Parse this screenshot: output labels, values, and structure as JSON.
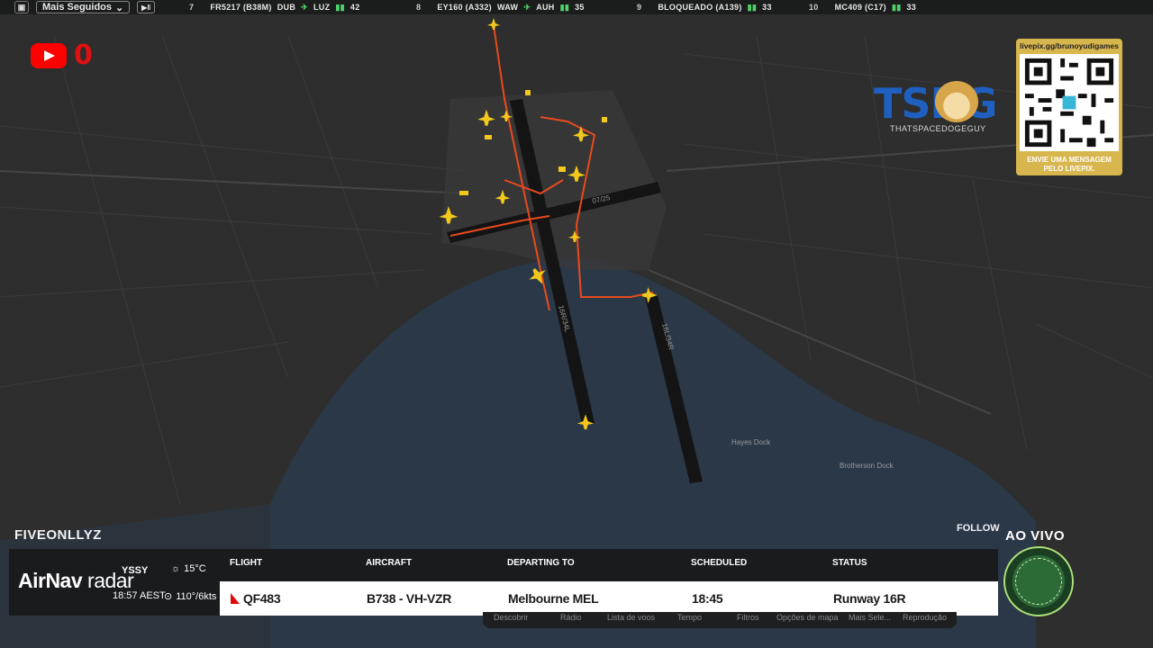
{
  "topbar": {
    "dropdown_label": "Mais Seguidos",
    "flights": [
      {
        "rank": "7",
        "callsign": "FR5217 (B38M)",
        "from": "DUB",
        "to": "LUZ",
        "count": "42"
      },
      {
        "rank": "8",
        "callsign": "EY160 (A332)",
        "from": "WAW",
        "to": "AUH",
        "count": "35"
      },
      {
        "rank": "9",
        "callsign": "BLOQUEADO (A139)",
        "from": "",
        "to": "",
        "count": "33"
      },
      {
        "rank": "10",
        "callsign": "MC409 (C17)",
        "from": "",
        "to": "",
        "count": "33"
      }
    ]
  },
  "overlay": {
    "youtube_count": "0",
    "tsdg_title": "TSDG",
    "tsdg_sub": "THATSPACEDOGEGUY",
    "livepix_url": "livepix.gg/brunoyudigames",
    "livepix_msg": "ENVIE UMA MENSAGEM PELO LIVEPIX."
  },
  "streamer": "FIVEONLLYZ",
  "follow_label": "FOLLOW",
  "live_label": "AO VIVO",
  "panel": {
    "brand_a": "AirNav",
    "brand_b": " radar",
    "airport": "YSSY",
    "local_time": "18:57 AEST",
    "temperature": "15°C",
    "wind": "110°/6kts",
    "headers": {
      "flight": "FLIGHT",
      "aircraft": "AIRCRAFT",
      "departing": "DEPARTING TO",
      "scheduled": "SCHEDULED",
      "status": "STATUS"
    },
    "row": {
      "flight": "QF483",
      "aircraft": "B738 - VH-VZR",
      "departing": "Melbourne MEL",
      "scheduled": "18:45",
      "status": "Runway 16R"
    }
  },
  "map": {
    "runway_labels": [
      "07/25",
      "16R/34L",
      "16L/34R"
    ],
    "places": [
      "Hayes Dock",
      "Brotherson Dock"
    ]
  },
  "menu": {
    "items": [
      "Descobrir",
      "Rádio",
      "Lista de voos",
      "Tempo",
      "Filtros",
      "Opções de mapa",
      "Mais Sele...",
      "Reprodução"
    ]
  },
  "colors": {
    "accent_plane": "#f2c81c",
    "route": "#e84a1f",
    "water": "#2a3a4c",
    "live_red": "#e10a0a"
  },
  "icons": [
    "window-icon",
    "chevron-down-icon",
    "play-pause-icon",
    "youtube-icon",
    "sun-icon",
    "wind-icon",
    "qantas-tail-icon",
    "plane-icon",
    "qr-code-icon"
  ]
}
